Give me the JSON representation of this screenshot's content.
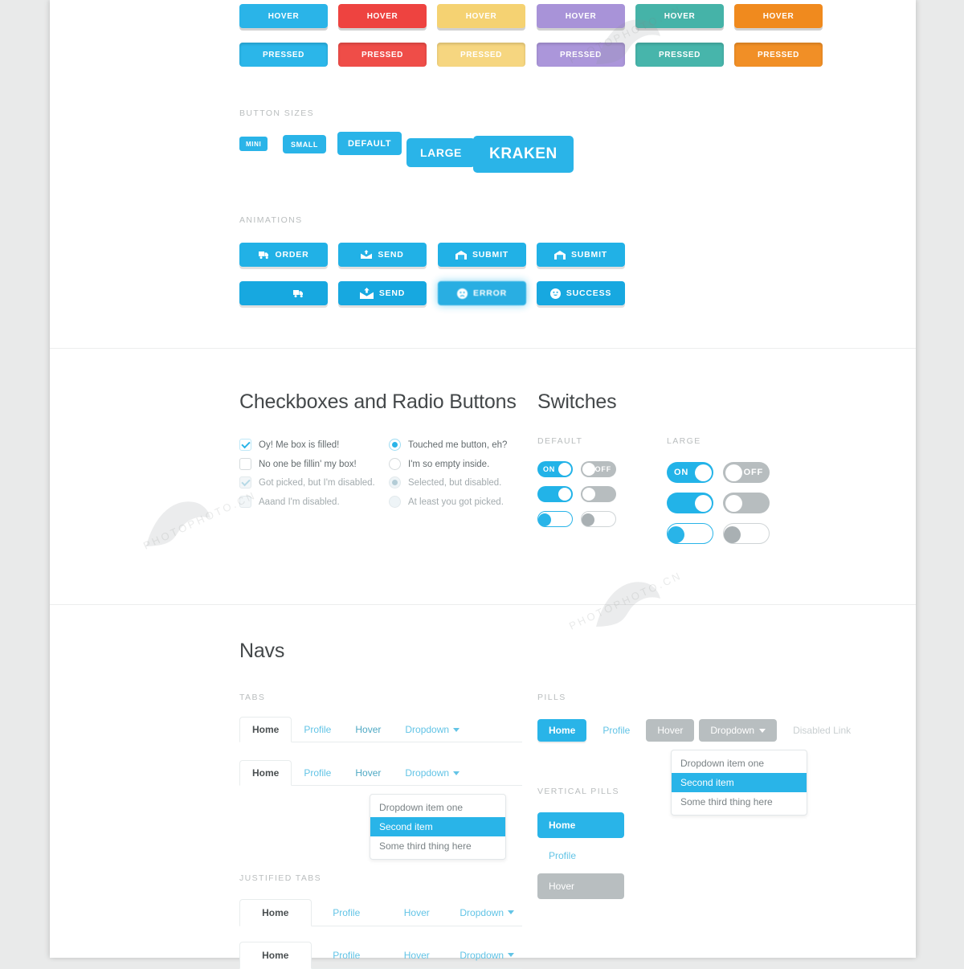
{
  "palette": {
    "states": [
      "HOVER",
      "PRESSED"
    ],
    "colors": [
      {
        "name": "blue",
        "hover": "#2ab4e8",
        "pressed": "#2bb6e9"
      },
      {
        "name": "red",
        "hover": "#ee4340",
        "pressed": "#ef4d48"
      },
      {
        "name": "yellow",
        "hover": "#f5d272",
        "pressed": "#f6d680"
      },
      {
        "name": "purple",
        "hover": "#a893d8",
        "pressed": "#ab96da"
      },
      {
        "name": "teal",
        "hover": "#45b3a8",
        "pressed": "#47b5ab"
      },
      {
        "name": "orange",
        "hover": "#f08a1e",
        "pressed": "#f18f26"
      }
    ]
  },
  "sizes": {
    "heading": "BUTTON SIZES",
    "buttons": [
      "MINI",
      "SMALL",
      "DEFAULT",
      "LARGE",
      "KRAKEN"
    ]
  },
  "animations": {
    "heading": "ANIMATIONS",
    "row1": [
      {
        "label": "ORDER",
        "icon": "truck-icon"
      },
      {
        "label": "SEND",
        "icon": "envelope-up-icon"
      },
      {
        "label": "SUBMIT",
        "icon": "envelope-open-icon"
      },
      {
        "label": "SUBMIT",
        "icon": "envelope-open-icon"
      }
    ],
    "row2": [
      {
        "label": "",
        "icon": "truck-icon"
      },
      {
        "label": "SEND",
        "icon": "envelope-up-icon"
      },
      {
        "label": "ERROR",
        "icon": "sad-face-icon"
      },
      {
        "label": "SUCCESS",
        "icon": "happy-face-icon"
      }
    ]
  },
  "checkboxes": {
    "title": "Checkboxes and Radio Buttons",
    "left": [
      {
        "label": "Oy! Me box is filled!",
        "checked": true,
        "disabled": false
      },
      {
        "label": "No one be fillin' my box!",
        "checked": false,
        "disabled": false
      },
      {
        "label": "Got picked, but I'm disabled.",
        "checked": true,
        "disabled": true
      },
      {
        "label": "Aaand I'm disabled.",
        "checked": false,
        "disabled": true
      }
    ],
    "right": [
      {
        "label": "Touched me button, eh?",
        "checked": true,
        "disabled": false
      },
      {
        "label": "I'm so empty inside.",
        "checked": false,
        "disabled": false
      },
      {
        "label": "Selected, but disabled.",
        "checked": true,
        "disabled": true
      },
      {
        "label": "At least you got picked.",
        "checked": false,
        "disabled": true
      }
    ]
  },
  "switches": {
    "title": "Switches",
    "default_heading": "DEFAULT",
    "large_heading": "LARGE",
    "on_label": "ON",
    "off_label": "OFF"
  },
  "navs": {
    "title": "Navs",
    "tabs_heading": "TABS",
    "pills_heading": "PILLS",
    "vertical_pills_heading": "VERTICAL PILLS",
    "justified_heading": "JUSTIFIED TABS",
    "items": [
      "Home",
      "Profile",
      "Hover",
      "Dropdown"
    ],
    "disabled_link": "Disabled Link",
    "vertical_items": [
      "Home",
      "Profile",
      "Hover"
    ],
    "dropdown_items": [
      "Dropdown item one",
      "Second item",
      "Some third thing here"
    ]
  },
  "watermark": {
    "text": "PHOTOPHOTO.CN"
  }
}
